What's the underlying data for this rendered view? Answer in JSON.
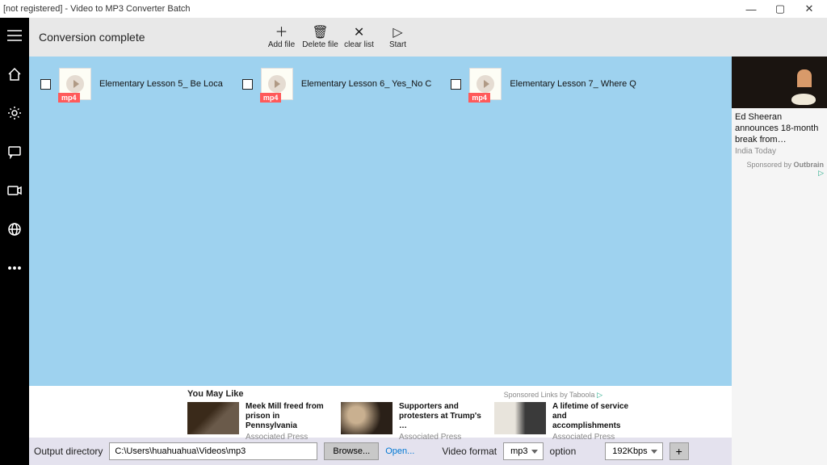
{
  "window": {
    "title": "[not registered] - Video to MP3 Converter Batch"
  },
  "toolbar": {
    "status": "Conversion complete",
    "add_file": "Add file",
    "delete_file": "Delete file",
    "clear_list": "clear list",
    "start": "Start"
  },
  "files": [
    {
      "name": "Elementary Lesson 5_ Be   Loca",
      "badge": "mp4"
    },
    {
      "name": "Elementary Lesson 6_ Yes_No C",
      "badge": "mp4"
    },
    {
      "name": "Elementary Lesson 7_ Where Q",
      "badge": "mp4"
    }
  ],
  "right_ad": {
    "title": "Ed Sheeran announces 18-month break from…",
    "source": "India Today",
    "sponsored": "Sponsored by",
    "brand": "Outbrain"
  },
  "ads_row": {
    "you_may_like": "You May Like",
    "sponsored_links": "Sponsored Links by Taboola",
    "cards": [
      {
        "title": "Meek Mill freed from prison in Pennsylvania",
        "source": "Associated Press"
      },
      {
        "title": "Supporters and protesters at Trump's …",
        "source": "Associated Press"
      },
      {
        "title": "A lifetime of service and accomplishments",
        "source": "Associated Press"
      }
    ]
  },
  "bottom": {
    "output_label": "Output directory",
    "path": "C:\\Users\\huahuahua\\Videos\\mp3",
    "browse": "Browse...",
    "open": "Open...",
    "video_format_label": "Video format",
    "format_value": "mp3",
    "option_label": "option",
    "bitrate_value": "192Kbps",
    "plus": "+"
  }
}
